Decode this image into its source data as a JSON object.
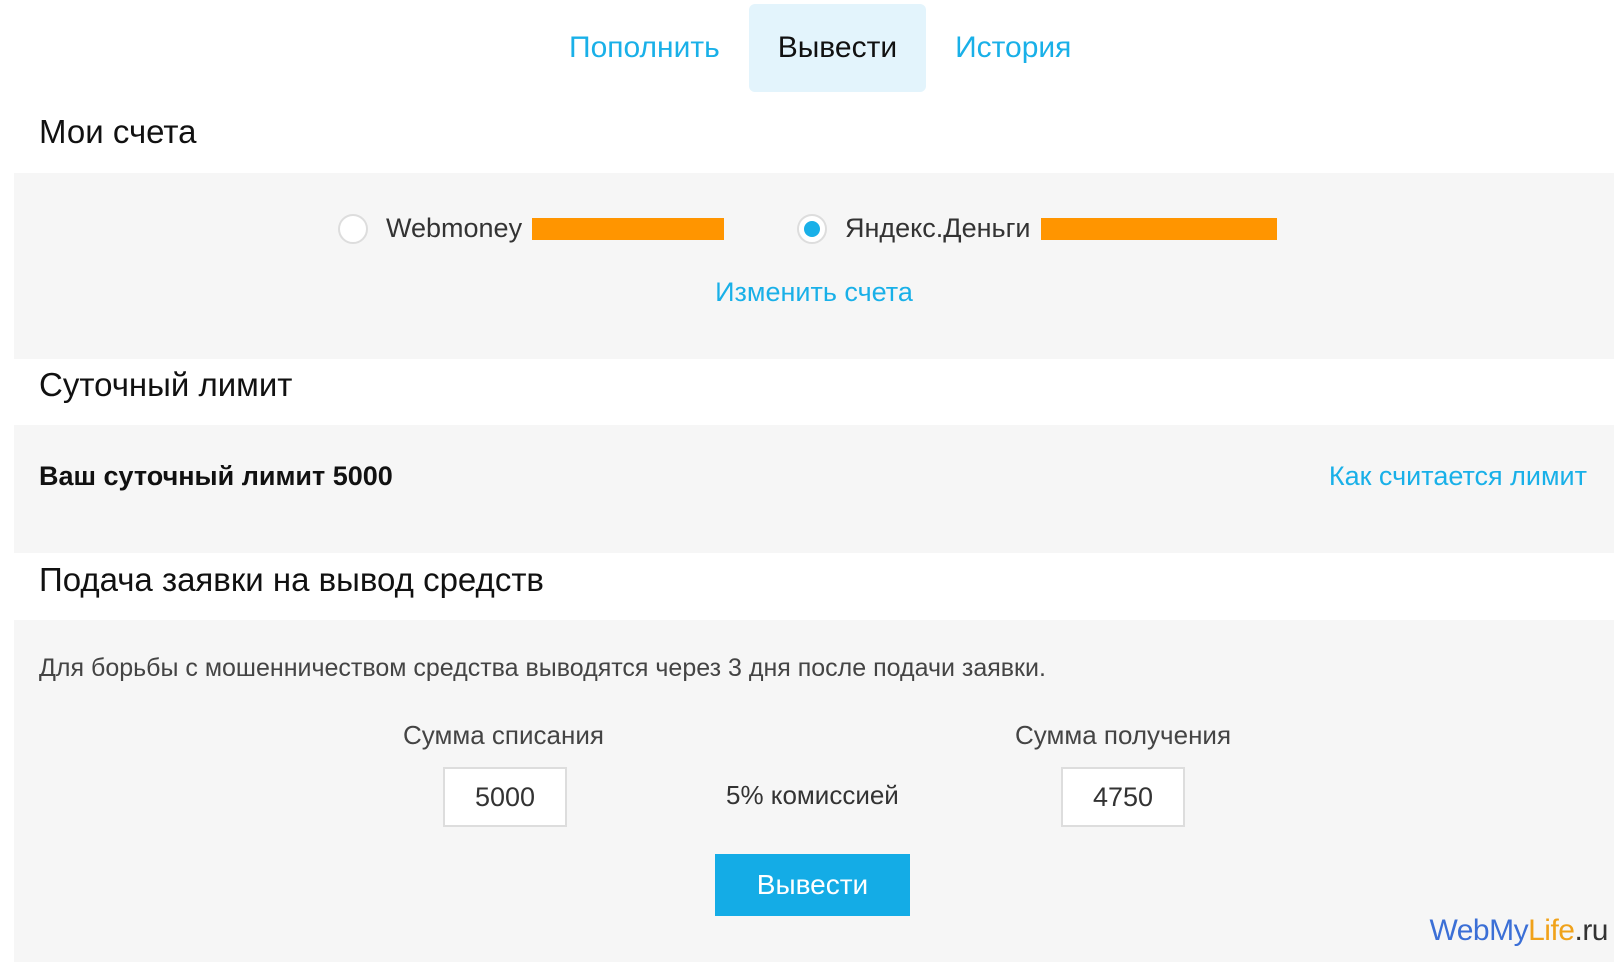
{
  "tabs": [
    {
      "label": "Пополнить",
      "active": false
    },
    {
      "label": "Вывести",
      "active": true
    },
    {
      "label": "История",
      "active": false
    }
  ],
  "accounts_section": {
    "title": "Мои счета",
    "options": [
      {
        "label": "Webmoney",
        "selected": false
      },
      {
        "label": "Яндекс.Деньги",
        "selected": true
      }
    ],
    "change_link": "Изменить счета"
  },
  "limit_section": {
    "title": "Суточный лимит",
    "text": "Ваш суточный лимит 5000",
    "link": "Как считается лимит"
  },
  "withdraw_section": {
    "title": "Подача заявки на вывод средств",
    "notice": "Для борьбы с мошенничеством средства выводятся через 3 дня после подачи заявки.",
    "debit_label": "Сумма списания",
    "debit_value": "5000",
    "fee_text": "5% комиссией",
    "receive_label": "Сумма получения",
    "receive_value": "4750",
    "submit_label": "Вывести"
  },
  "watermark": {
    "part1": "WebMy",
    "part2": "Life",
    "part3": ".ru"
  },
  "colors": {
    "accent": "#19b0e8",
    "button": "#14ace6",
    "redaction": "#ff9500",
    "panel": "#f6f6f6"
  }
}
